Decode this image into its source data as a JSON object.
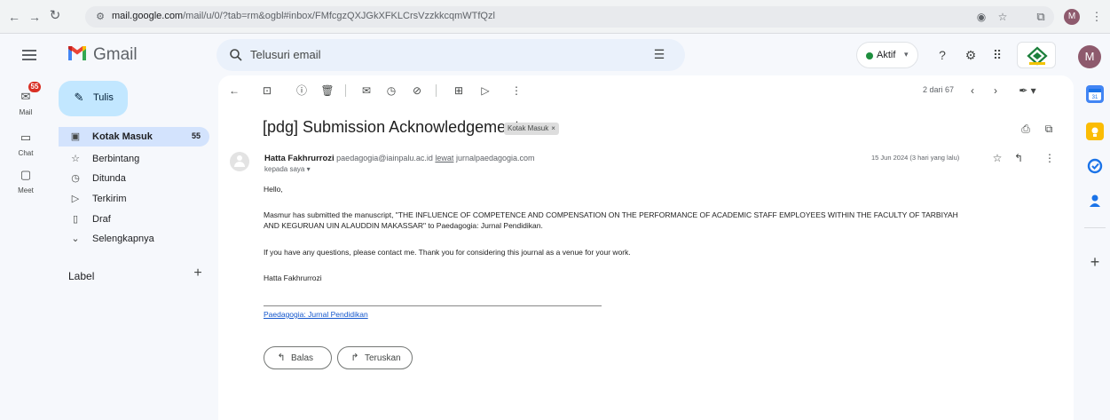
{
  "browser": {
    "back_icon": "arrow-left",
    "forward_icon": "arrow-right",
    "reload_icon": "reload",
    "url_host": "mail.google.com",
    "url_path": "/mail/u/0/?tab=rm&ogbl#inbox/FMfcgzQXJGkXFKLCrsVzzkkcqmWTfQzl",
    "profile_initial": "M"
  },
  "header": {
    "app_name": "Gmail",
    "search_placeholder": "Telusuri email",
    "status_label": "Aktif",
    "status_color": "#1e8e3e",
    "avatar_initial": "M"
  },
  "rail": {
    "mail_label": "Mail",
    "mail_badge": "55",
    "chat_label": "Chat",
    "meet_label": "Meet"
  },
  "nav": {
    "compose_label": "Tulis",
    "items": [
      {
        "label": "Kotak Masuk",
        "count": "55",
        "icon": "inbox-icon"
      },
      {
        "label": "Berbintang",
        "icon": "star-icon"
      },
      {
        "label": "Ditunda",
        "icon": "clock-icon"
      },
      {
        "label": "Terkirim",
        "icon": "send-icon"
      },
      {
        "label": "Draf",
        "icon": "draft-icon"
      },
      {
        "label": "Selengkapnya",
        "icon": "chevron-down-icon"
      }
    ],
    "label_heading": "Label"
  },
  "toolbar": {
    "pager": "2 dari 67"
  },
  "message": {
    "subject": "[pdg] Submission Acknowledgement",
    "label_chip": "Kotak Masuk",
    "sender_name": "Hatta Fakhrurrozi",
    "sender_email": "paedagogia@iainpalu.ac.id",
    "via_word": "lewat",
    "via_domain": "jurnalpaedagogia.com",
    "to_line": "kepada saya",
    "date": "15 Jun 2024 (3 hari yang lalu)",
    "greeting": "Hello,",
    "paragraph_1_line_1": "Masmur has submitted the manuscript, \"THE INFLUENCE OF COMPETENCE AND COMPENSATION ON THE PERFORMANCE OF ACADEMIC STAFF EMPLOYEES WITHIN THE FACULTY OF TARBIYAH",
    "paragraph_1_line_2": "AND KEGURUAN UIN ALAUDDIN MAKASSAR\" to Paedagogia: Jurnal Pendidikan.",
    "paragraph_2": "If you have any questions, please contact me. Thank you for considering this journal as a venue for your work.",
    "signature": "Hatta Fakhrurrozi",
    "journal_link": "Paedagogia: Jurnal Pendidikan",
    "reply_label": "Balas",
    "forward_label": "Teruskan"
  },
  "colors": {
    "compose_bg": "#c2e7ff",
    "active_nav_bg": "#d3e3fd",
    "link": "#1155cc",
    "badge": "#d93025"
  }
}
